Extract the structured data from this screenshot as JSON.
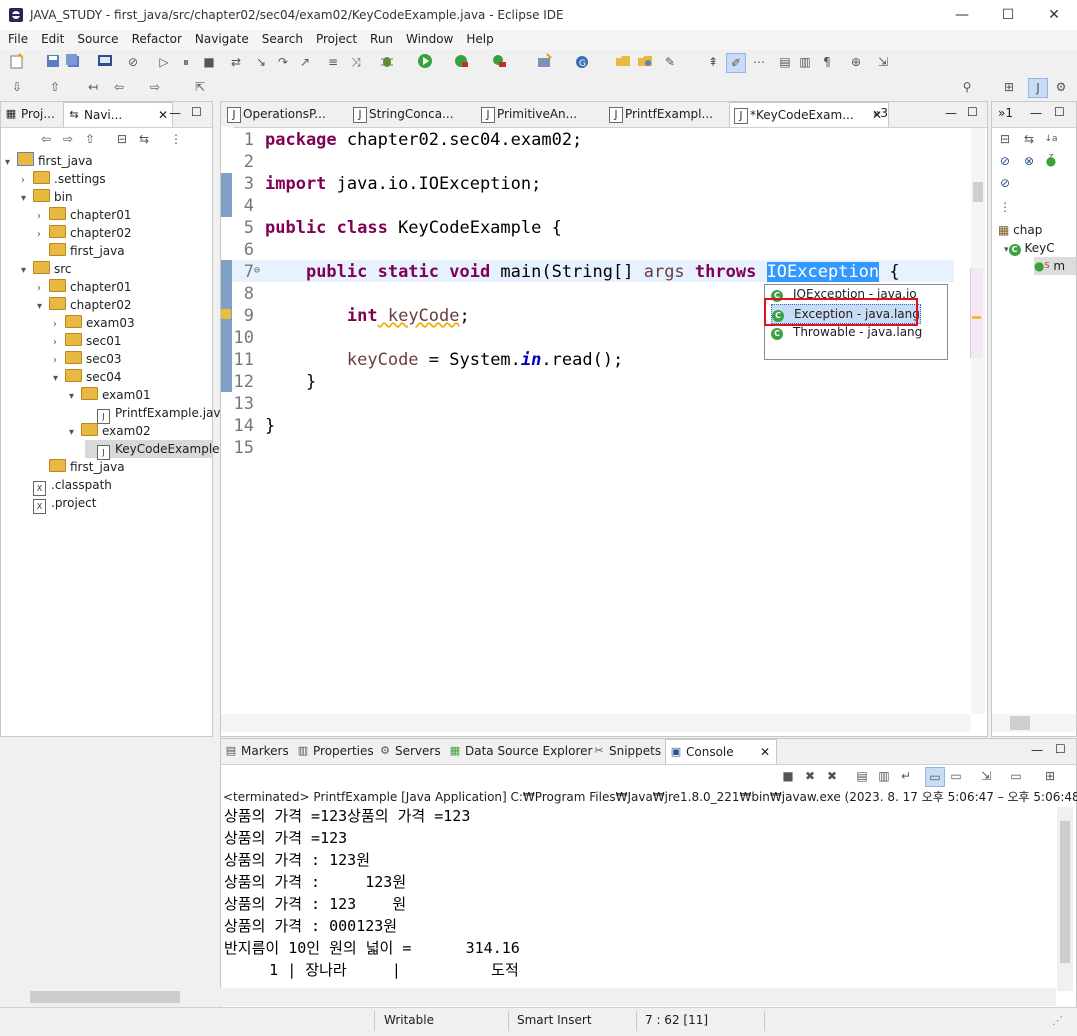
{
  "window": {
    "title": "JAVA_STUDY - first_java/src/chapter02/sec04/exam02/KeyCodeExample.java - Eclipse IDE",
    "minimize": "—",
    "maximize": "☐",
    "close": "✕"
  },
  "menu": [
    "File",
    "Edit",
    "Source",
    "Refactor",
    "Navigate",
    "Search",
    "Project",
    "Run",
    "Window",
    "Help"
  ],
  "left_panel": {
    "tabs": [
      {
        "label": "Proj...",
        "icon": "package-explorer-icon"
      },
      {
        "label": "Navi...",
        "icon": "navigator-icon"
      }
    ],
    "tree": [
      {
        "label": "first_java",
        "indent": 0,
        "arrow": "▾",
        "type": "project"
      },
      {
        "label": ".settings",
        "indent": 1,
        "arrow": "›",
        "type": "folder"
      },
      {
        "label": "bin",
        "indent": 1,
        "arrow": "▾",
        "type": "folder"
      },
      {
        "label": "chapter01",
        "indent": 2,
        "arrow": "›",
        "type": "folder"
      },
      {
        "label": "chapter02",
        "indent": 2,
        "arrow": "›",
        "type": "folder"
      },
      {
        "label": "first_java",
        "indent": 2,
        "arrow": "",
        "type": "folder"
      },
      {
        "label": "src",
        "indent": 1,
        "arrow": "▾",
        "type": "folder"
      },
      {
        "label": "chapter01",
        "indent": 2,
        "arrow": "›",
        "type": "folder"
      },
      {
        "label": "chapter02",
        "indent": 2,
        "arrow": "▾",
        "type": "folder"
      },
      {
        "label": "exam03",
        "indent": 3,
        "arrow": "›",
        "type": "folder"
      },
      {
        "label": "sec01",
        "indent": 3,
        "arrow": "›",
        "type": "folder"
      },
      {
        "label": "sec03",
        "indent": 3,
        "arrow": "›",
        "type": "folder"
      },
      {
        "label": "sec04",
        "indent": 3,
        "arrow": "▾",
        "type": "folder"
      },
      {
        "label": "exam01",
        "indent": 4,
        "arrow": "▾",
        "type": "folder"
      },
      {
        "label": "PrintfExample.java",
        "indent": 5,
        "arrow": "",
        "type": "java"
      },
      {
        "label": "exam02",
        "indent": 4,
        "arrow": "▾",
        "type": "folder"
      },
      {
        "label": "KeyCodeExample.ja",
        "indent": 5,
        "arrow": "",
        "type": "java",
        "selected": true
      },
      {
        "label": "first_java",
        "indent": 2,
        "arrow": "",
        "type": "folder"
      },
      {
        "label": ".classpath",
        "indent": 1,
        "arrow": "",
        "type": "xfile"
      },
      {
        "label": ".project",
        "indent": 1,
        "arrow": "",
        "type": "xfile"
      }
    ]
  },
  "editor": {
    "tabs": [
      {
        "label": "OperationsP..."
      },
      {
        "label": "StringConca..."
      },
      {
        "label": "PrimitiveAn..."
      },
      {
        "label": "PrintfExampl..."
      },
      {
        "label": "*KeyCodeExam...",
        "active": true,
        "close": "✕"
      }
    ],
    "overflow": "»3",
    "line_numbers": [
      "1",
      "2",
      "3",
      "4",
      "5",
      "6",
      "7",
      "8",
      "9",
      "10",
      "11",
      "12",
      "13",
      "14",
      "15"
    ],
    "code": {
      "l1_kw": "package",
      "l1_rest": " chapter02.sec04.exam02;",
      "l3_kw": "import",
      "l3_rest": " java.io.IOException;",
      "l5_kw": "public class",
      "l5_rest": " KeyCodeExample {",
      "l7_kw1": "public static void",
      "l7_mid": " main(String[] ",
      "l7_arg": "args",
      "l7_kw2": " throws ",
      "l7_sel": "IOException",
      "l7_end": " {",
      "l9_kw": "int",
      "l9_var": " keyCode",
      "l9_end": ";",
      "l11_var": "keyCode",
      "l11_mid": " = System.",
      "l11_fld": "in",
      "l11_end": ".read();",
      "l12": "}",
      "l14": "}"
    },
    "popup": [
      "IOException - java.io",
      "Exception - java.lang",
      "Throwable - java.lang"
    ],
    "fold_marker": "⊖"
  },
  "outline": {
    "tab_overflow": "»1",
    "items": [
      {
        "label": "chap"
      },
      {
        "label": "KeyC"
      },
      {
        "label": "m"
      }
    ],
    "sort_label": "↓a z"
  },
  "bottom_panel": {
    "tabs": [
      "Markers",
      "Properties",
      "Servers",
      "Data Source Explorer",
      "Snippets",
      "Console"
    ],
    "console_close": "✕",
    "terminated": "<terminated> PrintfExample [Java Application] C:₩Program Files₩Java₩jre1.8.0_221₩bin₩javaw.exe  (2023. 8. 17 오후 5:06:47 – 오후 5:06:48)",
    "lines": [
      "상품의 가격 =123상품의 가격 =123",
      "상품의 가격 =123",
      "상품의 가격 : 123원",
      "상품의 가격 :     123원",
      "상품의 가격 : 123    원",
      "상품의 가격 : 000123원",
      "반지름이 10인 원의 넓이 =      314.16",
      "     1 | 장나라     |          도적"
    ]
  },
  "status": {
    "mode": "Writable",
    "insert": "Smart Insert",
    "position": "7 : 62 [11]"
  }
}
